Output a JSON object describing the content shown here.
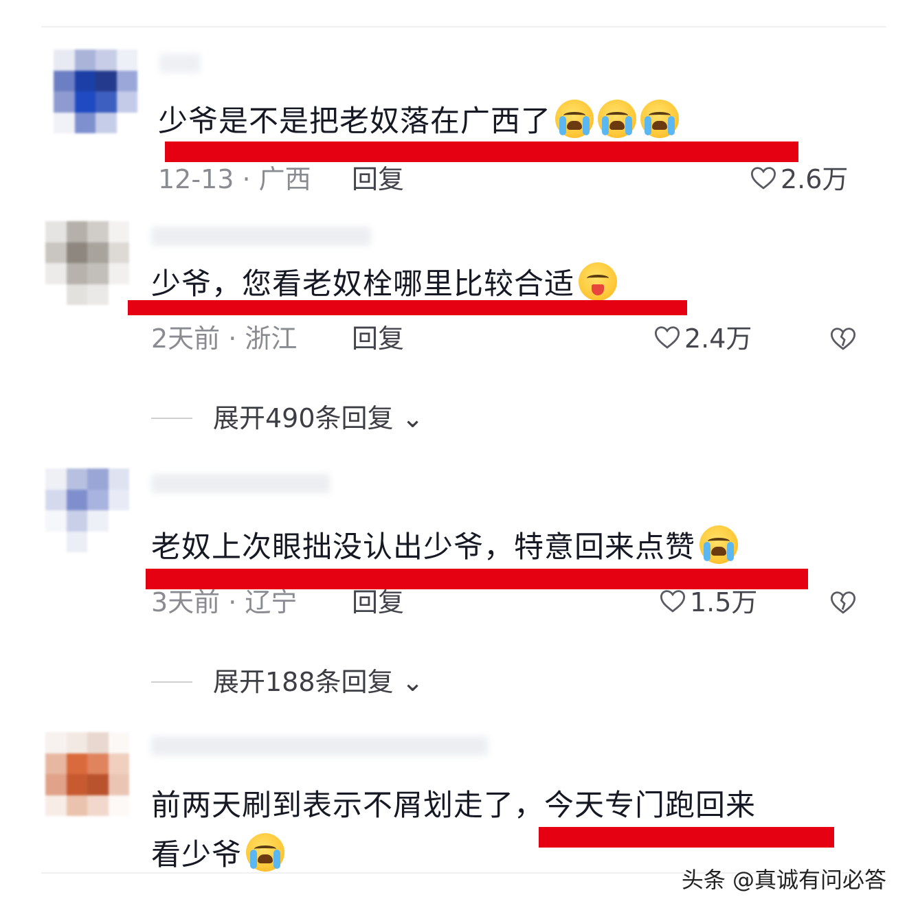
{
  "comments": [
    {
      "content": "少爷是不是把老奴落在广西了",
      "meta": "12-13 · 广西",
      "reply": "回复",
      "likes": "2.6万",
      "emoji": [
        "loudly-crying-face",
        "loudly-crying-face",
        "loudly-crying-face"
      ]
    },
    {
      "content": "少爷，您看老奴栓哪里比较合适",
      "meta": "2天前 · 浙江",
      "reply": "回复",
      "likes": "2.4万",
      "emoji": [
        "winking-tongue-face"
      ],
      "expand": "展开490条回复"
    },
    {
      "content": "老奴上次眼拙没认出少爷，特意回来点赞",
      "meta": "3天前 · 辽宁",
      "reply": "回复",
      "likes": "1.5万",
      "emoji": [
        "loudly-crying-face"
      ],
      "expand": "展开188条回复"
    },
    {
      "content_line1": "前两天刷到表示不屑划走了，今天专门跑回来",
      "content_line2": "看少爷",
      "emoji": [
        "loudly-crying-face"
      ]
    }
  ],
  "watermark": "头条 @真诚有问必答",
  "colors": {
    "highlight": "#e50012",
    "text": "#161823",
    "meta": "#8a8b91"
  }
}
